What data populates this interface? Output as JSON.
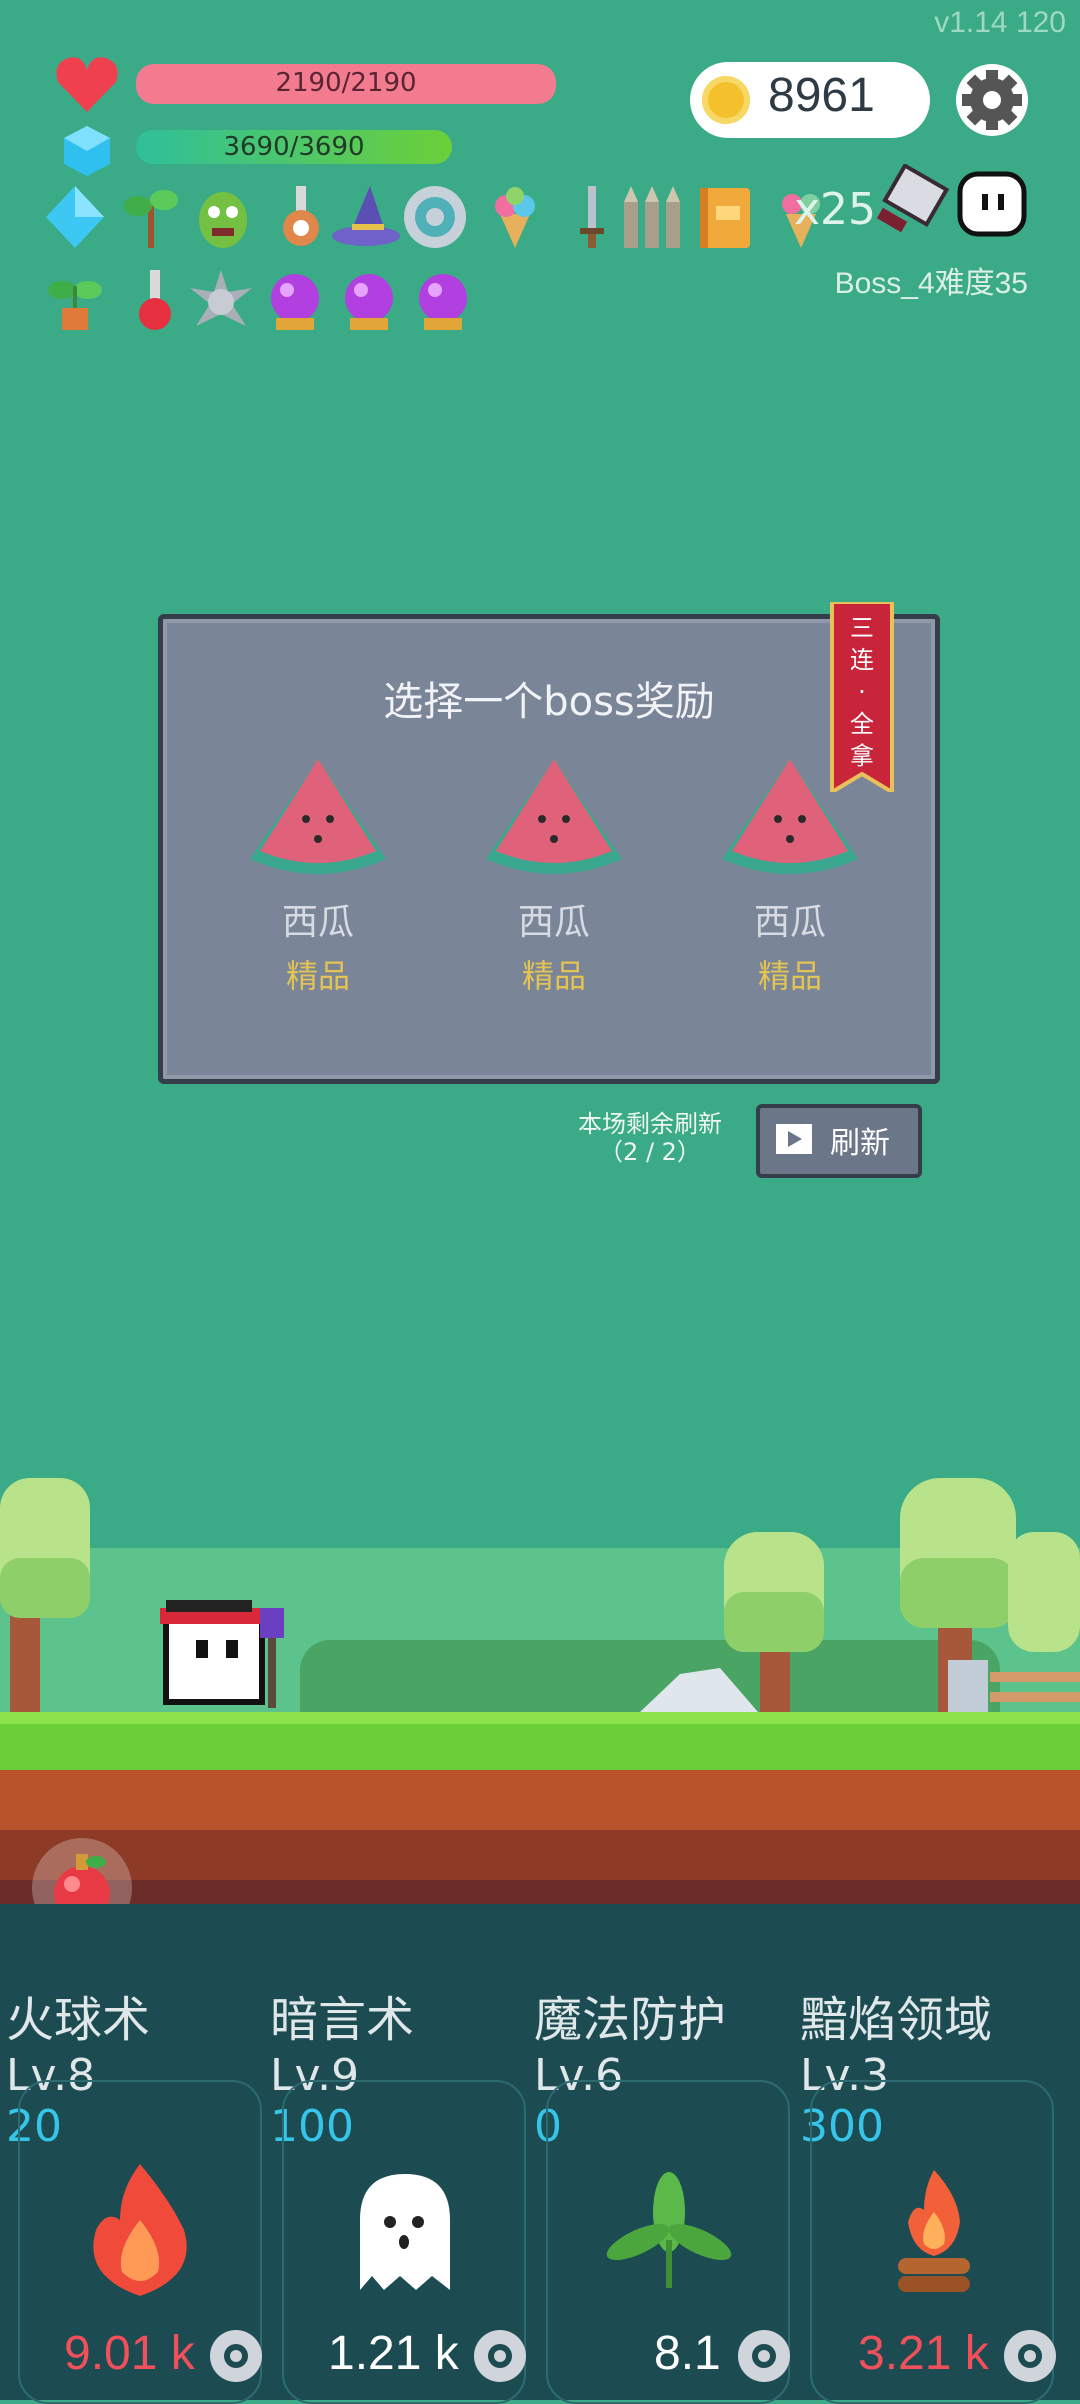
{
  "version": "v1.14",
  "fps": "120",
  "hp": {
    "text": "2190/2190",
    "fill": 1.0
  },
  "mp": {
    "text": "3690/3690",
    "fill": 1.0
  },
  "coins": "8961",
  "item_multiplier": "x25",
  "boss_label": "Boss_4难度35",
  "items_row1": [
    "diamond-icon",
    "sapling-icon",
    "goblin-icon",
    "bottle-icon",
    "wizard-hat-icon",
    "shield-ring-icon",
    "ice-cream-icon",
    "sword-icon",
    "bullets-icon",
    "book-icon",
    "ice-cream-gem-icon"
  ],
  "items_row2": [
    "potted-plant-icon",
    "red-potion-icon",
    "spike-ball-icon",
    "purple-orb-icon",
    "purple-orb-icon",
    "purple-orb-icon"
  ],
  "panel": {
    "title": "选择一个boss奖励",
    "ribbon": [
      "三",
      "连",
      "·",
      "全",
      "拿"
    ],
    "rewards": [
      {
        "name": "西瓜",
        "grade": "精品",
        "icon": "watermelon-icon"
      },
      {
        "name": "西瓜",
        "grade": "精品",
        "icon": "watermelon-icon"
      },
      {
        "name": "西瓜",
        "grade": "精品",
        "icon": "watermelon-icon"
      }
    ]
  },
  "refresh": {
    "info_line1": "本场剩余刷新",
    "info_line2": "（2 / 2）",
    "button": "刷新"
  },
  "skills": [
    {
      "name": "火球术",
      "level": "Lv.8",
      "value": "20",
      "damage": "9.01 k",
      "damage_color": "red",
      "icon": "fire-icon"
    },
    {
      "name": "暗言术",
      "level": "Lv.9",
      "value": "100",
      "damage": "1.21 k",
      "damage_color": "white",
      "icon": "ghost-icon"
    },
    {
      "name": "魔法防护",
      "level": "Lv.6",
      "value": "0",
      "damage": "8.1",
      "damage_color": "white",
      "icon": "leaf-icon"
    },
    {
      "name": "黯焰领域",
      "level": "Lv.3",
      "value": "300",
      "damage": "3.21 k",
      "damage_color": "red",
      "icon": "campfire-icon"
    }
  ],
  "colors": {
    "background": "#3aab86",
    "hp": "#f06b86",
    "mp": "#4ccb6a",
    "panel": "#7a8598",
    "grade": "#e3c353"
  }
}
